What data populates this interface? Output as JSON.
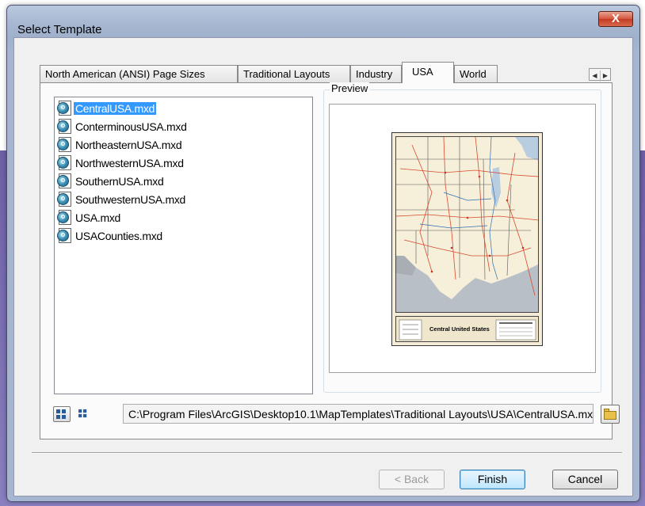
{
  "window": {
    "title": "Select Template",
    "close_glyph": "X"
  },
  "tabs": [
    {
      "label": "North American (ANSI) Page Sizes"
    },
    {
      "label": "Traditional Layouts"
    },
    {
      "label": "Industry"
    },
    {
      "label": "USA",
      "active": true
    },
    {
      "label": "World"
    }
  ],
  "tab_scroll": {
    "left_icon": "triangle-left-icon",
    "right_icon": "triangle-right-icon",
    "left_glyph": "◀",
    "right_glyph": "▶"
  },
  "file_list": {
    "items": [
      {
        "label": "CentralUSA.mxd",
        "selected": true
      },
      {
        "label": "ConterminousUSA.mxd"
      },
      {
        "label": "NortheasternUSA.mxd"
      },
      {
        "label": "NorthwesternUSA.mxd"
      },
      {
        "label": "SouthernUSA.mxd"
      },
      {
        "label": "SouthwesternUSA.mxd"
      },
      {
        "label": "USA.mxd"
      },
      {
        "label": "USACounties.mxd"
      }
    ],
    "item_icon": "map-document-icon"
  },
  "preview": {
    "label": "Preview",
    "map_title": "Central United States"
  },
  "path": {
    "value": "C:\\Program Files\\ArcGIS\\Desktop10.1\\MapTemplates\\Traditional Layouts\\USA\\CentralUSA.mxd"
  },
  "buttons": {
    "back": "< Back",
    "finish": "Finish",
    "cancel": "Cancel"
  },
  "colors": {
    "selection": "#3399ff",
    "title_bar": "#a9b9d2",
    "close_button": "#c23b22"
  }
}
